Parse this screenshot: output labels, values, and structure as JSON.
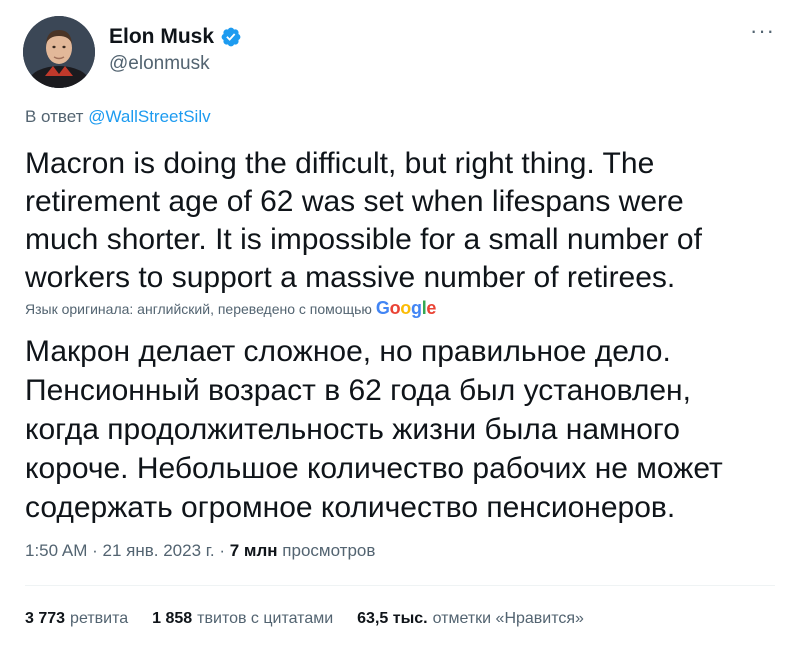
{
  "author": {
    "name": "Elon Musk",
    "handle": "@elonmusk",
    "verified_icon": "verified-badge-icon",
    "verified_color": "#1d9bf0"
  },
  "reply": {
    "prefix": "В ответ",
    "mention": "@WallStreetSilv"
  },
  "tweet": {
    "text": "Macron is doing the difficult, but right thing. The retirement age of 62 was set when lifespans were much shorter. It is impossible for a small number of workers to support a massive number of retirees.",
    "translation_note": "Язык оригинала: английский, переведено с помощью",
    "translator": "Google",
    "translated_text": "Макрон делает сложное, но правильное дело. Пенсионный возраст в 62 года был установлен, когда продолжительность жизни была намного короче. Небольшое количество рабочих не может содержать огромное количество пенсионеров."
  },
  "meta": {
    "time": "1:50 AM",
    "date": "21 янв. 2023 г.",
    "views_count": "7 млн",
    "views_label": "просмотров"
  },
  "stats": {
    "retweets_count": "3 773",
    "retweets_label": "ретвита",
    "quotes_count": "1 858",
    "quotes_label": "твитов с цитатами",
    "likes_count": "63,5 тыс.",
    "likes_label": "отметки «Нравится»"
  },
  "colors": {
    "text_primary": "#0f1419",
    "text_secondary": "#536471",
    "link": "#1d9bf0"
  }
}
